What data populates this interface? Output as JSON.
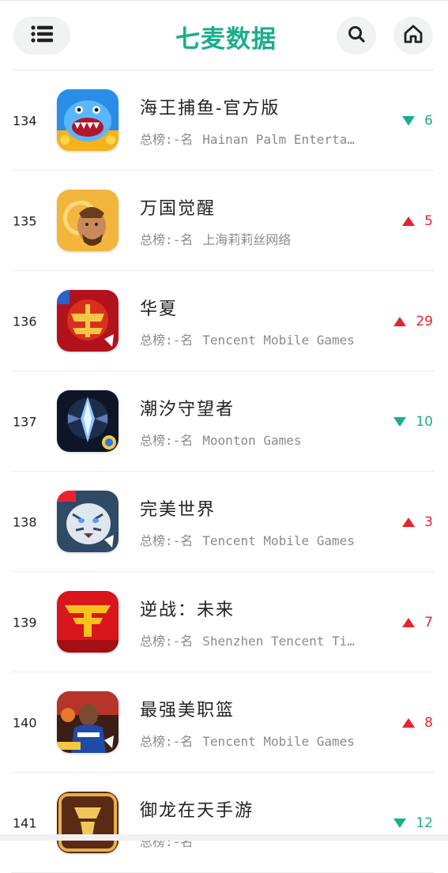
{
  "header": {
    "logo_text": "七麦数据",
    "menu_icon": "list-icon",
    "search_icon": "search-icon",
    "home_icon": "home-icon",
    "brand_color": "#1aae8c"
  },
  "colors": {
    "up": "#e8232f",
    "down": "#1bae8d"
  },
  "apps": [
    {
      "rank": "134",
      "name": "海王捕鱼-官方版",
      "sub_label": "总榜:-名",
      "developer": "Hainan Palm Enterta…",
      "trend": "down",
      "change": "6",
      "icon": "shark-fish-icon"
    },
    {
      "rank": "135",
      "name": "万国觉醒",
      "sub_label": "总榜:-名",
      "developer": "上海莉莉丝网络",
      "trend": "up",
      "change": "5",
      "icon": "warrior-icon"
    },
    {
      "rank": "136",
      "name": "华夏",
      "sub_label": "总榜:-名",
      "developer": "Tencent Mobile Games",
      "trend": "up",
      "change": "29",
      "icon": "huaxia-icon"
    },
    {
      "rank": "137",
      "name": "潮汐守望者",
      "sub_label": "总榜:-名",
      "developer": "Moonton Games",
      "trend": "down",
      "change": "10",
      "icon": "crystal-icon"
    },
    {
      "rank": "138",
      "name": "完美世界",
      "sub_label": "总榜:-名",
      "developer": "Tencent Mobile Games",
      "trend": "up",
      "change": "3",
      "icon": "white-tiger-icon"
    },
    {
      "rank": "139",
      "name": "逆战：未来",
      "sub_label": "总榜:-名",
      "developer": "Shenzhen Tencent Ti…",
      "trend": "up",
      "change": "7",
      "icon": "nizhan-logo-icon"
    },
    {
      "rank": "140",
      "name": "最强美职篮",
      "sub_label": "总榜:-名",
      "developer": "Tencent Mobile Games",
      "trend": "up",
      "change": "8",
      "icon": "basketball-player-icon"
    },
    {
      "rank": "141",
      "name": "御龙在天手游",
      "sub_label": "总榜:-名",
      "developer": "",
      "trend": "down",
      "change": "12",
      "icon": "dragon-icon"
    }
  ]
}
